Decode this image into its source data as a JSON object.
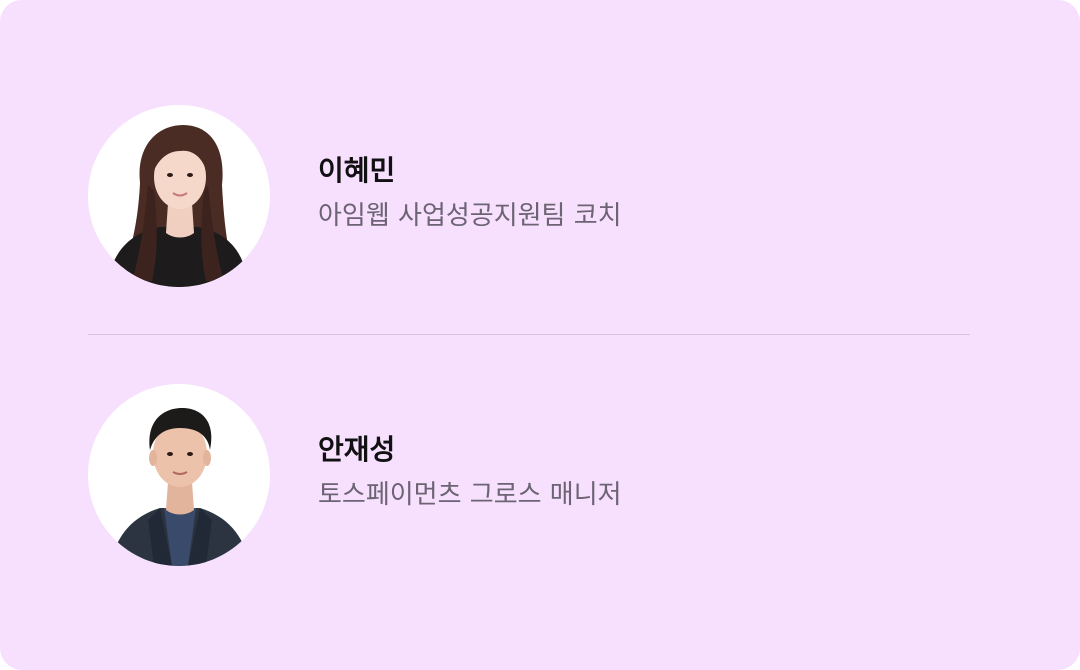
{
  "people": [
    {
      "name": "이혜민",
      "role": "아임웹 사업성공지원팀 코치"
    },
    {
      "name": "안재성",
      "role": "토스페이먼츠 그로스 매니저"
    }
  ],
  "colors": {
    "card_background": "#f7e0fe",
    "name_text": "#111111",
    "role_text": "#6c6373",
    "divider": "#d5c2db"
  }
}
